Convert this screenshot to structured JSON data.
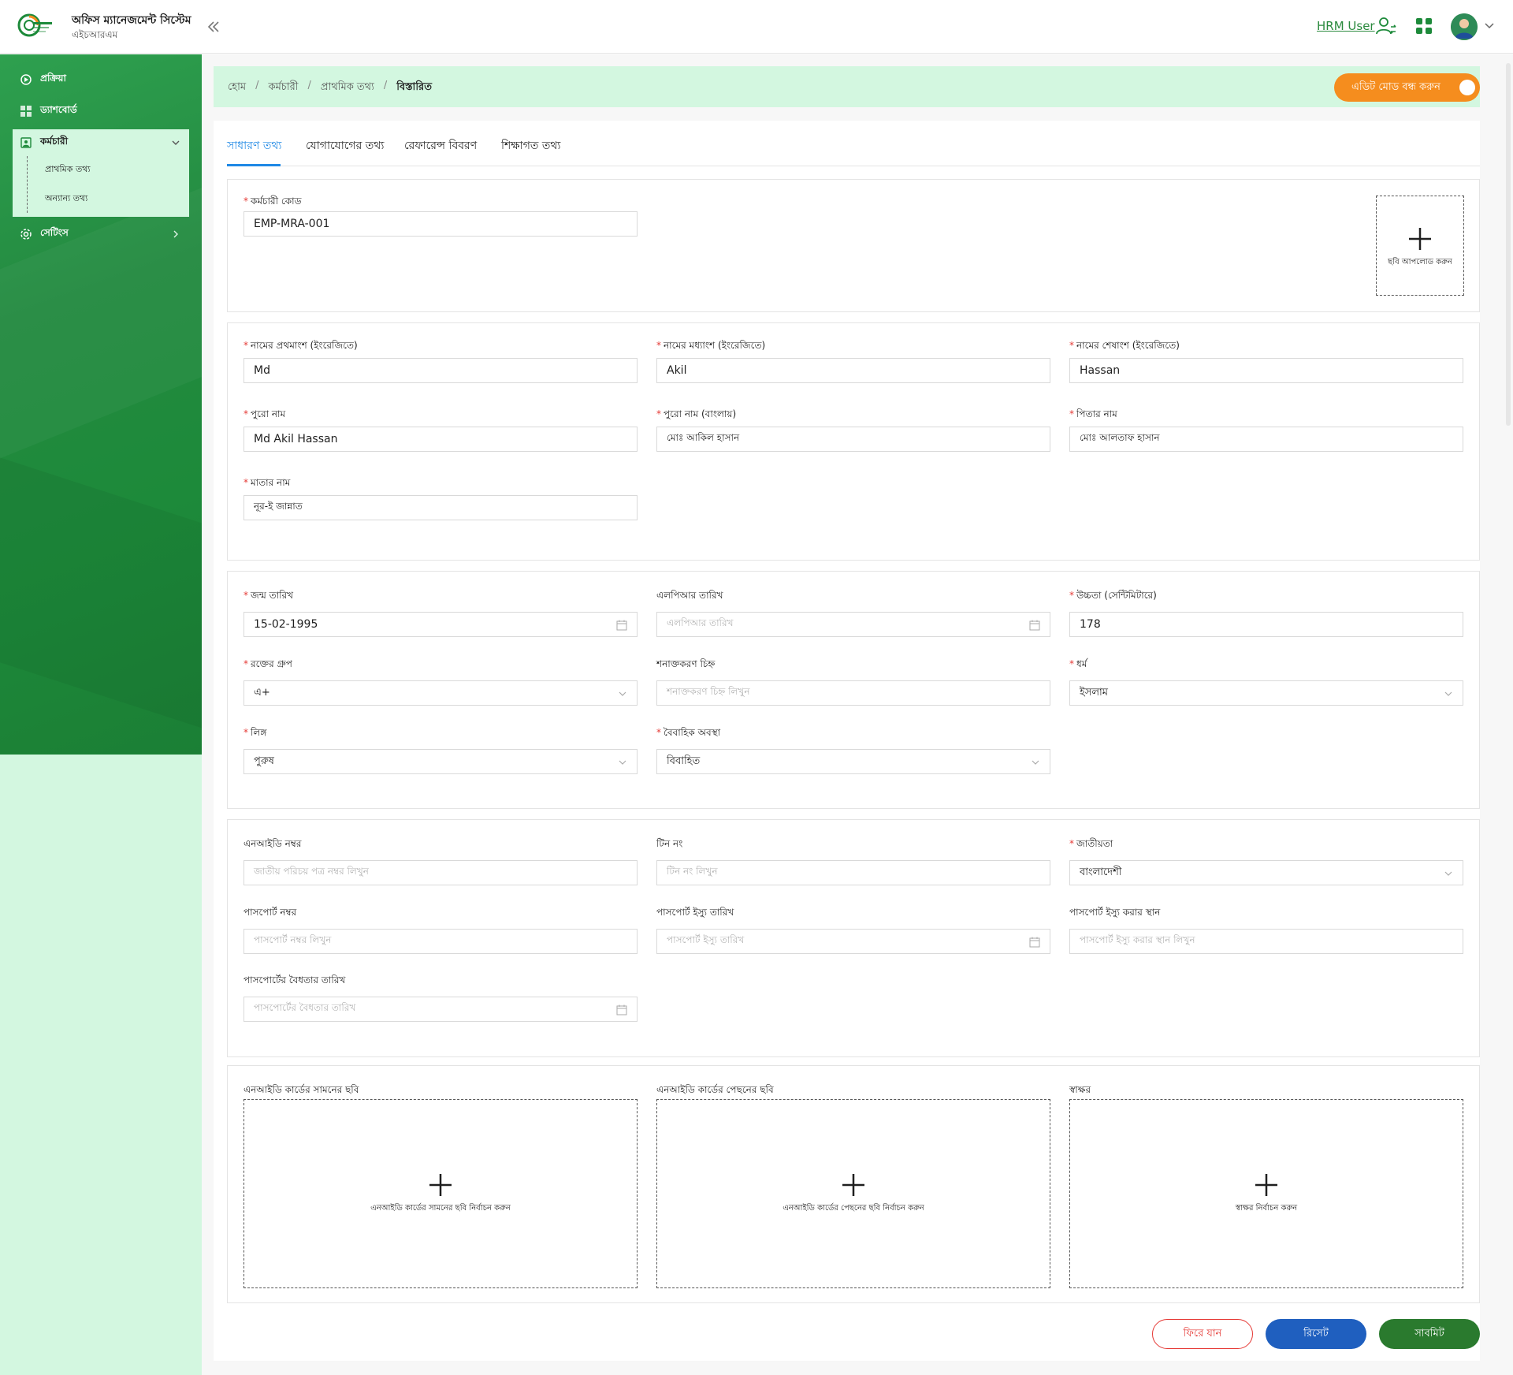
{
  "header": {
    "app_title": "অফিস ম্যানেজমেন্ট সিস্টেম",
    "app_subtitle": "এইচআরএম",
    "user_name": "HRM User",
    "icons": {
      "logo": "logo",
      "collapse": "double-chevron-left-icon",
      "user_switch": "user-switch-icon",
      "apps": "grid-icon",
      "avatar": "avatar",
      "caret": "chevron-down-icon"
    }
  },
  "sidebar": {
    "items": [
      {
        "label": "প্রক্রিয়া",
        "icon": "process-icon"
      },
      {
        "label": "ড্যাশবোর্ড",
        "icon": "dashboard-icon"
      },
      {
        "label": "কর্মচারী",
        "icon": "employee-icon",
        "expanded": true,
        "children": [
          {
            "label": "প্রাথমিক তথ্য"
          },
          {
            "label": "অন্যান্য তথ্য"
          }
        ]
      },
      {
        "label": "সেটিংস",
        "icon": "settings-icon"
      }
    ]
  },
  "breadcrumb": {
    "items": [
      "হোম",
      "কর্মচারী",
      "প্রাথমিক তথ্য"
    ],
    "current": "বিস্তারিত",
    "separator": "/"
  },
  "edit_mode_button": "এডিট মোড বন্ধ করুন",
  "tabs": {
    "items": [
      "সাধারণ তথ্য",
      "যোগাযোগের তথ্য",
      "রেফারেন্স বিবরণ",
      "শিক্ষাগত তথ্য"
    ],
    "active_index": 0
  },
  "section1": {
    "employee_code": {
      "label": "কর্মচারী কোড",
      "required": true,
      "value": "EMP-MRA-001"
    },
    "photo_upload": "ছবি আপলোড করুন"
  },
  "section2": {
    "first_name_en": {
      "label": "নামের প্রথমাংশ (ইংরেজিতে)",
      "required": true,
      "value": "Md"
    },
    "middle_name_en": {
      "label": "নামের মধ্যাংশ (ইংরেজিতে)",
      "required": true,
      "value": "Akil"
    },
    "last_name_en": {
      "label": "নামের শেষাংশ (ইংরেজিতে)",
      "required": true,
      "value": "Hassan"
    },
    "full_name": {
      "label": "পুরো নাম",
      "required": true,
      "value": "Md Akil Hassan"
    },
    "full_name_bn": {
      "label": "পুরো নাম (বাংলায়)",
      "required": true,
      "value": "মোঃ আকিল হাসান"
    },
    "father_name": {
      "label": "পিতার নাম",
      "required": true,
      "value": "মোঃ আলতাফ হাসান"
    },
    "mother_name": {
      "label": "মাতার নাম",
      "required": true,
      "value": "নূর-ই জান্নাত"
    }
  },
  "section3": {
    "birth_date": {
      "label": "জন্ম তারিখ",
      "required": true,
      "value": "15-02-1995"
    },
    "lpr_date": {
      "label": "এলপিআর তারিখ",
      "required": false,
      "placeholder": "এলপিআর তারিখ"
    },
    "height": {
      "label": "উচ্চতা (সেন্টিমিটারে)",
      "required": true,
      "value": "178"
    },
    "blood_group": {
      "label": "রক্তের গ্রুপ",
      "required": true,
      "value": "এ+"
    },
    "identification_mark": {
      "label": "শনাক্তকরণ চিহ্ন",
      "required": false,
      "placeholder": "শনাক্তকরণ চিহ্ন লিখুন"
    },
    "religion": {
      "label": "ধর্ম",
      "required": true,
      "value": "ইসলাম"
    },
    "gender": {
      "label": "লিঙ্গ",
      "required": true,
      "value": "পুরুষ"
    },
    "marital_status": {
      "label": "বৈবাহিক অবস্থা",
      "required": true,
      "value": "বিবাহিত"
    }
  },
  "section4": {
    "nid": {
      "label": "এনআইডি নম্বর",
      "required": false,
      "placeholder": "জাতীয় পরিচয় পত্র নম্বর লিখুন"
    },
    "tin": {
      "label": "টিন নং",
      "required": false,
      "placeholder": "টিন নং লিখুন"
    },
    "nationality": {
      "label": "জাতীয়তা",
      "required": true,
      "value": "বাংলাদেশী"
    },
    "passport_no": {
      "label": "পাসপোর্ট নম্বর",
      "required": false,
      "placeholder": "পাসপোর্ট নম্বর লিখুন"
    },
    "passport_issue_date": {
      "label": "পাসপোর্ট ইস্যু তারিখ",
      "required": false,
      "placeholder": "পাসপোর্ট ইস্যু তারিখ"
    },
    "passport_issue_place": {
      "label": "পাসপোর্ট ইস্যু করার স্থান",
      "required": false,
      "placeholder": "পাসপোর্ট ইস্যু করার স্থান লিখুন"
    },
    "passport_expiry": {
      "label": "পাসপোর্টের বৈধতার তারিখ",
      "required": false,
      "placeholder": "পাসপোর্টের বৈধতার তারিখ"
    }
  },
  "section5": {
    "nid_front": {
      "label": "এনআইডি কার্ডের সামনের ছবি",
      "action": "এনআইডি কার্ডের সামনের ছবি নির্বাচন করুন"
    },
    "nid_back": {
      "label": "এনআইডি কার্ডের পেছনের ছবি",
      "action": "এনআইডি কার্ডের পেছনের ছবি নির্বাচন করুন"
    },
    "signature": {
      "label": "স্বাক্ষর",
      "action": "স্বাক্ষর নির্বাচন করুন"
    }
  },
  "actions": {
    "back": "ফিরে যান",
    "reset": "রিসেট",
    "submit": "সাবমিট"
  },
  "colors": {
    "brand_green": "#1d8a3a",
    "light_green": "#d3f7e0",
    "accent_blue": "#1e88e5",
    "orange": "#f58d1e",
    "danger": "#e53935",
    "reset_blue": "#1f5fbf",
    "submit_green": "#2a7a2e"
  }
}
